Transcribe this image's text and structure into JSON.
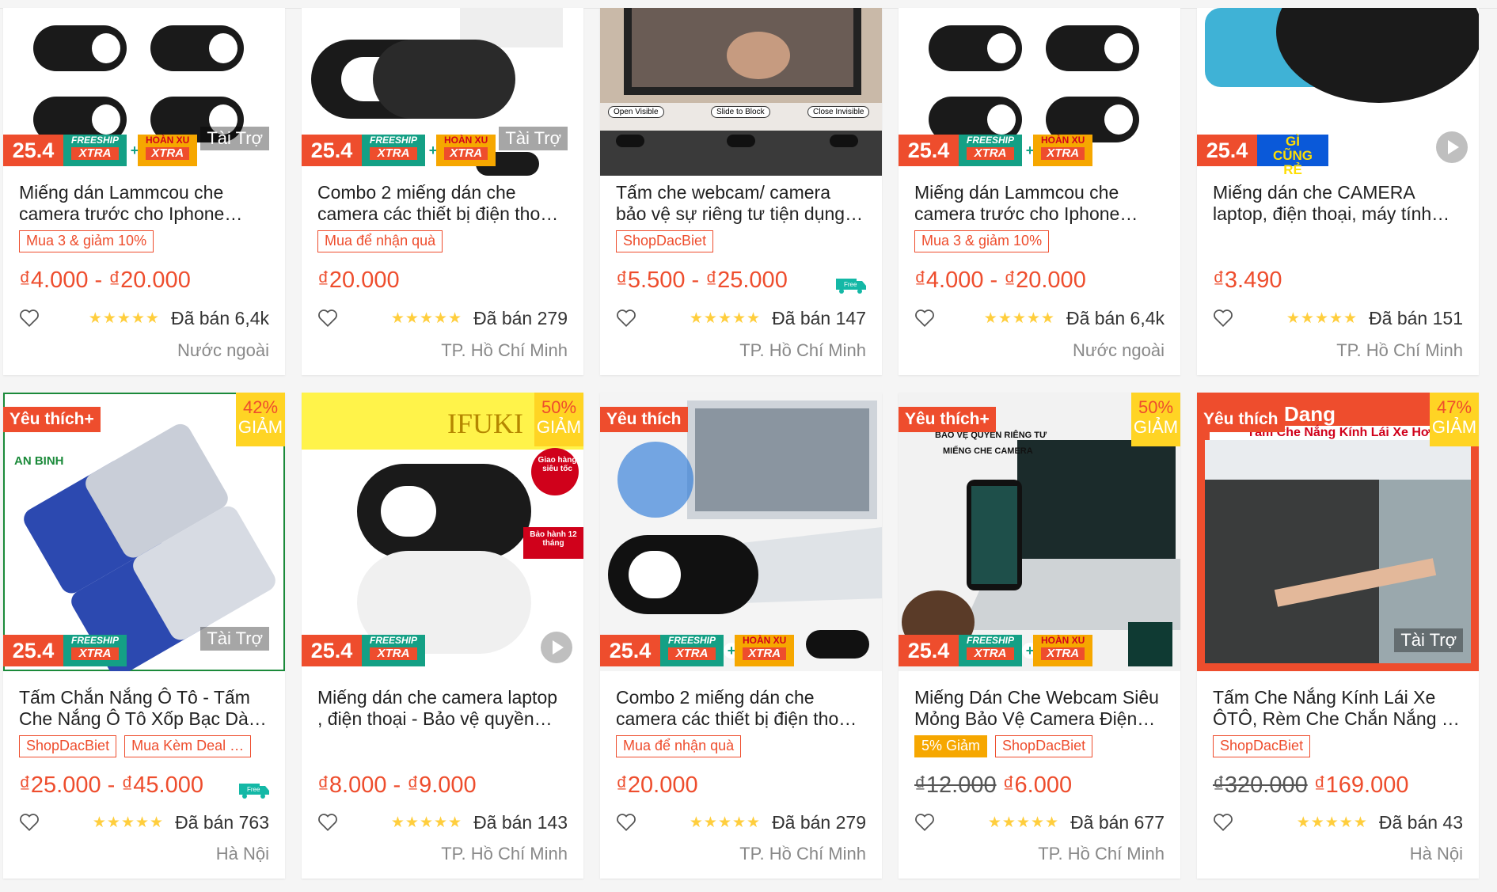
{
  "colors": {
    "accent": "#ee4d2d",
    "star": "#ffce3d",
    "xtra": "#14a085",
    "xu": "#f6a700",
    "cheap": "#0a59d9"
  },
  "labels": {
    "sale_date": "25.4",
    "sponsor": "Tài Trợ",
    "freeship": "FREESHIP",
    "xtra": "XTRA",
    "hoan_xu": "HOÀN XU",
    "giam": "GIẢM",
    "stars": "★★★★★",
    "free": "Free"
  },
  "products": [
    {
      "title": "Miếng dán Lammcou che\ncamera trước cho Iphone…",
      "tags": [
        "Mua 3 & giảm 10%"
      ],
      "price_from": "₫4.000",
      "price_to": "₫20.000",
      "sold": "Đã bán 6,4k",
      "location": "Nước ngoài"
    },
    {
      "title": "Combo 2 miếng dán che\ncamera các thiết bị điện tho…",
      "tags": [
        "Mua để nhận quà"
      ],
      "price_from": "₫20.000",
      "sold": "Đã bán 279",
      "location": "TP. Hồ Chí Minh"
    },
    {
      "title": "Tấm che webcam/ camera\nbảo vệ sự riêng tư tiện dụng…",
      "tags": [
        "ShopDacBiet"
      ],
      "price_from": "₫5.500",
      "price_to": "₫25.000",
      "sold": "Đã bán 147",
      "location": "TP. Hồ Chí Minh",
      "img_text": [
        "Open Visible",
        "Slide to Block",
        "Close Invisible"
      ]
    },
    {
      "title": "Miếng dán Lammcou che\ncamera trước cho Iphone…",
      "tags": [
        "Mua 3 & giảm 10%"
      ],
      "price_from": "₫4.000",
      "price_to": "₫20.000",
      "sold": "Đã bán 6,4k",
      "location": "Nước ngoài"
    },
    {
      "title": "Miếng dán che CAMERA\nlaptop, điện thoại, máy tính…",
      "tags": [],
      "price_from": "₫3.490",
      "sold": "Đã bán 151",
      "location": "TP. Hồ Chí Minh",
      "cheap_badge": "GÌ CŨNG RẺ"
    },
    {
      "title": "Tấm Chắn Nắng Ô Tô - Tấm\nChe Nắng Ô Tô Xốp Bạc Dà…",
      "tags": [
        "ShopDacBiet",
        "Mua Kèm Deal …"
      ],
      "price_from": "₫25.000",
      "price_to": "₫45.000",
      "sold": "Đã bán 763",
      "location": "Hà Nội",
      "favorite": "Yêu thích+",
      "discount": "42%",
      "img_text": [
        "AN BINH"
      ]
    },
    {
      "title": "Miếng dán che camera laptop\n, điện thoại - Bảo vệ quyền…",
      "tags": [],
      "price_from": "₫8.000",
      "price_to": "₫9.000",
      "sold": "Đã bán 143",
      "location": "TP. Hồ Chí Minh",
      "discount": "50%",
      "img_text": [
        "IFUKI",
        "Giao hàng siêu tốc",
        "Bảo hành 12 tháng"
      ]
    },
    {
      "title": "Combo 2 miếng dán che\ncamera các thiết bị điện tho…",
      "tags": [
        "Mua để nhận quà"
      ],
      "price_from": "₫20.000",
      "sold": "Đã bán 279",
      "location": "TP. Hồ Chí Minh",
      "favorite": "Yêu thích"
    },
    {
      "title": "Miếng Dán Che Webcam Siêu\nMỏng Bảo Vệ Camera Điện…",
      "tags": [
        "5% Giảm",
        "ShopDacBiet"
      ],
      "price_old": "₫12.000",
      "price_from": "₫6.000",
      "sold": "Đã bán 677",
      "location": "TP. Hồ Chí Minh",
      "favorite": "Yêu thích+",
      "discount": "50%",
      "img_text": [
        "BẢO VỆ QUYỀN RIÊNG TƯ",
        "MIẾNG CHE CAMERA"
      ]
    },
    {
      "title": "Tấm Che Nắng Kính Lái Xe\nÔTÔ, Rèm Che Chắn Nắng …",
      "tags": [
        "ShopDacBiet"
      ],
      "price_old": "₫320.000",
      "price_from": "₫169.000",
      "sold": "Đã bán 43",
      "location": "Hà Nội",
      "favorite": "Yêu thích",
      "discount": "47%",
      "img_text": [
        "Tấm Che Nắng Kính Lái Xe Hơi",
        "Dang"
      ]
    }
  ]
}
